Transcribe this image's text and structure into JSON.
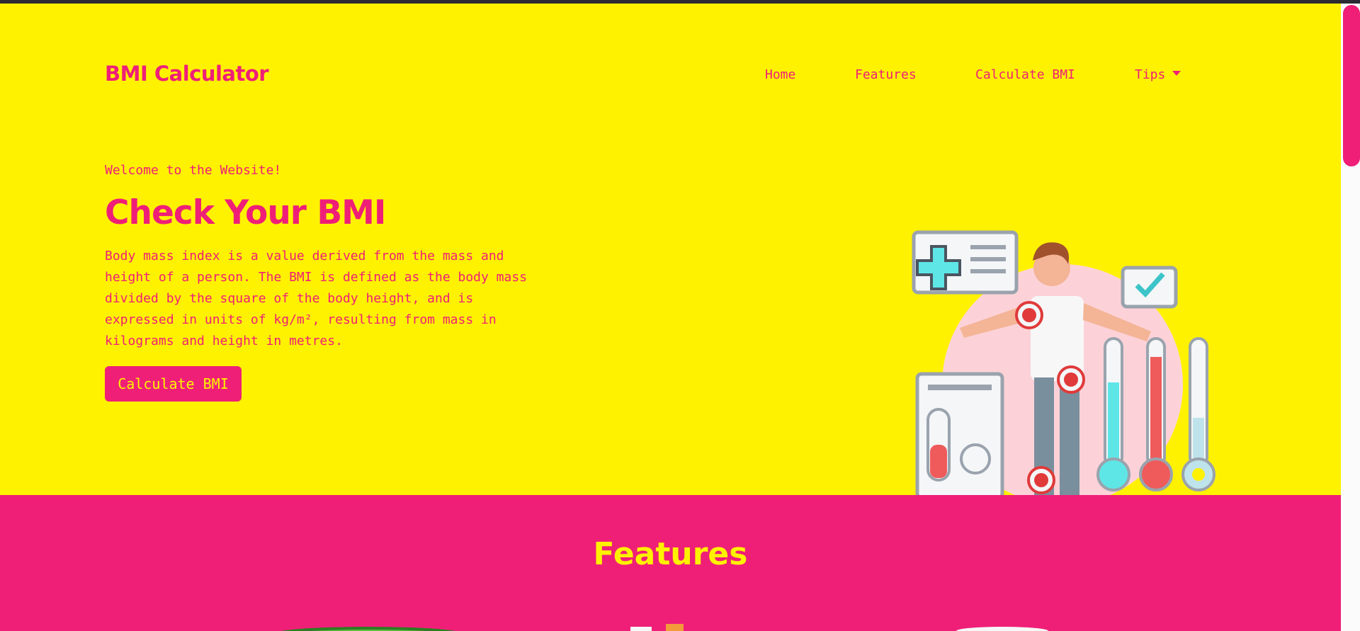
{
  "brand": "BMI Calculator",
  "nav": {
    "home": "Home",
    "features": "Features",
    "calculate": "Calculate BMI",
    "tips": "Tips"
  },
  "hero": {
    "welcome": "Welcome to the Website!",
    "title": "Check Your BMI",
    "description": "Body mass index is a value derived from the mass and height of a person. The BMI is defined as the body mass divided by the square of the body height, and is expressed in units of kg/m², resulting from mass in kilograms and height in metres.",
    "cta_label": "Calculate BMI",
    "illustration": "health-checkup-illustration"
  },
  "features": {
    "title": "Features"
  },
  "colors": {
    "yellow": "#fff200",
    "pink": "#ef1f78",
    "topbar": "#2b2b33"
  },
  "icons": {
    "tips_dropdown": "caret-down-icon"
  }
}
